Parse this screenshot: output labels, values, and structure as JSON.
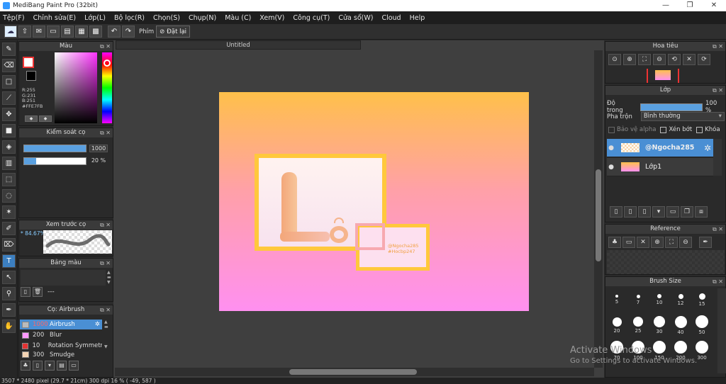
{
  "window": {
    "title": "MediBang Paint Pro (32bit)",
    "controls": [
      "—",
      "❐",
      "✕"
    ]
  },
  "menu": [
    "Tệp(F)",
    "Chỉnh sửa(E)",
    "Lớp(L)",
    "Bộ lọc(R)",
    "Chọn(S)",
    "Chụp(N)",
    "Màu (C)",
    "Xem(V)",
    "Công cụ(T)",
    "Cửa sổ(W)",
    "Cloud",
    "Help"
  ],
  "toolbar": {
    "key_label": "Phím",
    "reset_label": "Đặt lại"
  },
  "color_panel": {
    "title": "Màu",
    "rgb": [
      "R:255",
      "G:231",
      "B:251",
      "#FFE7FB"
    ],
    "accent": "#ff33ff"
  },
  "brush_control": {
    "title": "Kiểm soát cọ",
    "size_value": "1000",
    "size_fraction": 1.0,
    "opacity_value": "20 %",
    "opacity_fraction": 0.2
  },
  "brush_preview": {
    "title": "Xem trước cọ",
    "zoom": "* 84.67%"
  },
  "palette": {
    "title": "Bảng màu",
    "label": "---"
  },
  "brush_list": {
    "title": "Cọ: Airbrush",
    "items": [
      {
        "size": "1000",
        "name": "Airbrush",
        "color": "#bbbbbb"
      },
      {
        "size": "200",
        "name": "Blur",
        "color": "#ff99ff"
      },
      {
        "size": "10",
        "name": "Rotation Symmetry",
        "color": "#e33333"
      },
      {
        "size": "300",
        "name": "Smudge",
        "color": "#f4d4b4"
      }
    ]
  },
  "canvas": {
    "tab_title": "Untitled",
    "credit_line1": "@Ngocha285",
    "credit_line2": "#Hocbp247"
  },
  "navigator": {
    "title": "Hoa tiêu"
  },
  "layers": {
    "title": "Lớp",
    "opacity_label": "Độ trong",
    "opacity_value": "100 %",
    "blend_label": "Pha trộn",
    "blend_value": "Bình thường",
    "protect_alpha": "Bảo vệ alpha",
    "clipping": "Xén bớt",
    "lock": "Khóa",
    "items": [
      {
        "name": "@Ngocha285",
        "selected": true
      },
      {
        "name": "Lớp1",
        "selected": false
      }
    ]
  },
  "reference": {
    "title": "Reference"
  },
  "brush_size": {
    "title": "Brush Size",
    "sizes": [
      "5",
      "7",
      "10",
      "12",
      "15",
      "20",
      "25",
      "30",
      "40",
      "50",
      "70",
      "100",
      "150",
      "200",
      "300"
    ]
  },
  "status": {
    "text": "3507 * 2480 pixel   (29.7 * 21cm)   300 dpi   16 %   ( -49, 587 )"
  },
  "watermark": {
    "line1": "Activate Windows",
    "line2": "Go to Settings to activate Windows."
  }
}
